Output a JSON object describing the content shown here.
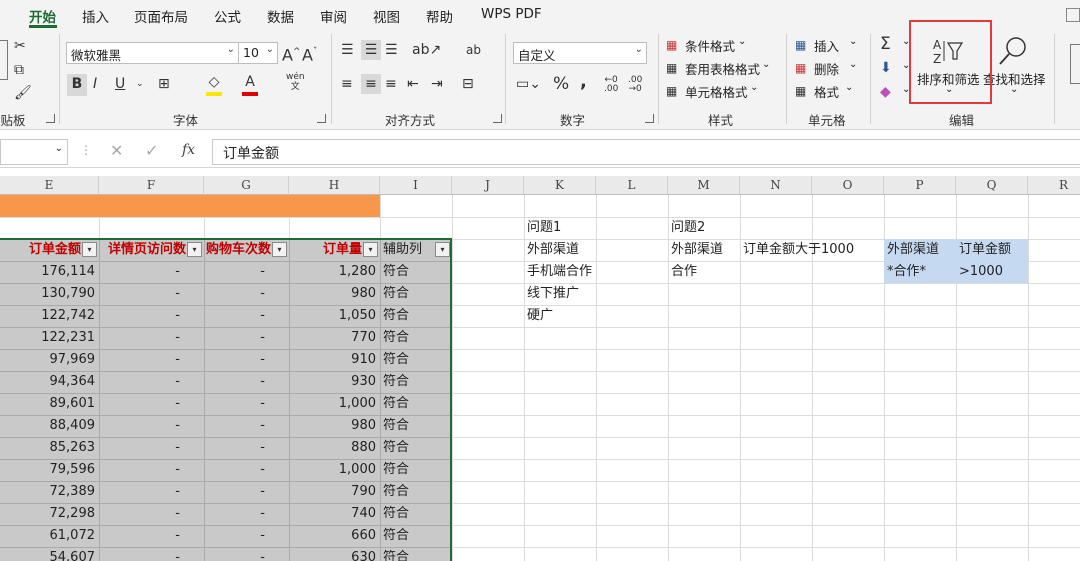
{
  "menu": {
    "tabs": [
      "开始",
      "插入",
      "页面布局",
      "公式",
      "数据",
      "审阅",
      "视图",
      "帮助",
      "WPS PDF"
    ],
    "active": "开始"
  },
  "ribbon": {
    "clipboard": {
      "label": "粘贴板"
    },
    "font": {
      "name": "微软雅黑",
      "size": "10",
      "label": "字体",
      "bold": "B",
      "italic": "I",
      "underline": "U",
      "wen": "wén\n文",
      "grow": "A^",
      "shrink": "Aˇ"
    },
    "align": {
      "label": "对齐方式",
      "ab": "ab"
    },
    "number": {
      "format": "自定义",
      "label": "数字",
      "percent": "%",
      "comma": ","
    },
    "styles": {
      "label": "样式",
      "cond": "条件格式",
      "table": "套用表格格式",
      "cell": "单元格格式"
    },
    "cells": {
      "label": "单元格",
      "insert": "插入",
      "delete": "删除",
      "format": "格式"
    },
    "editing": {
      "label": "编辑",
      "sort_filter": "排序和筛选",
      "find": "查找和选择"
    },
    "accent": "#1e6b34",
    "highlight_color": "#e03b3b"
  },
  "formula_bar": {
    "value": "订单金额",
    "fx": "fx"
  },
  "columns": [
    "E",
    "F",
    "G",
    "H",
    "I",
    "J",
    "K",
    "L",
    "M",
    "N",
    "O",
    "P",
    "Q",
    "R"
  ],
  "table": {
    "headers": [
      "订单金额",
      "详情页访问数",
      "购物车次数",
      "订单量",
      "辅助列"
    ],
    "rows": [
      [
        "176,114",
        "-",
        "-",
        "1,280",
        "符合"
      ],
      [
        "130,790",
        "-",
        "-",
        "980",
        "符合"
      ],
      [
        "122,742",
        "-",
        "-",
        "1,050",
        "符合"
      ],
      [
        "122,231",
        "-",
        "-",
        "770",
        "符合"
      ],
      [
        "97,969",
        "-",
        "-",
        "910",
        "符合"
      ],
      [
        "94,364",
        "-",
        "-",
        "930",
        "符合"
      ],
      [
        "89,601",
        "-",
        "-",
        "1,000",
        "符合"
      ],
      [
        "88,409",
        "-",
        "-",
        "980",
        "符合"
      ],
      [
        "85,263",
        "-",
        "-",
        "880",
        "符合"
      ],
      [
        "79,596",
        "-",
        "-",
        "1,000",
        "符合"
      ],
      [
        "72,389",
        "-",
        "-",
        "790",
        "符合"
      ],
      [
        "72,298",
        "-",
        "-",
        "740",
        "符合"
      ],
      [
        "61,072",
        "-",
        "-",
        "660",
        "符合"
      ],
      [
        "54,607",
        "-",
        "-",
        "630",
        "符合"
      ]
    ]
  },
  "side": {
    "q1": "问题1",
    "q1_items": [
      "外部渠道",
      "手机端合作",
      "线下推广",
      "硬广"
    ],
    "q2": "问题2",
    "q2_a": "外部渠道",
    "q2_b": "订单金额大于1000",
    "q2_c": "合作",
    "crit_h1": "外部渠道",
    "crit_h2": "订单金额",
    "crit_v1": "*合作*",
    "crit_v2": ">1000"
  },
  "colors": {
    "orange_band": "#f8974a",
    "criteria_fill": "#c5d9f1",
    "header_red": "#c00000"
  }
}
